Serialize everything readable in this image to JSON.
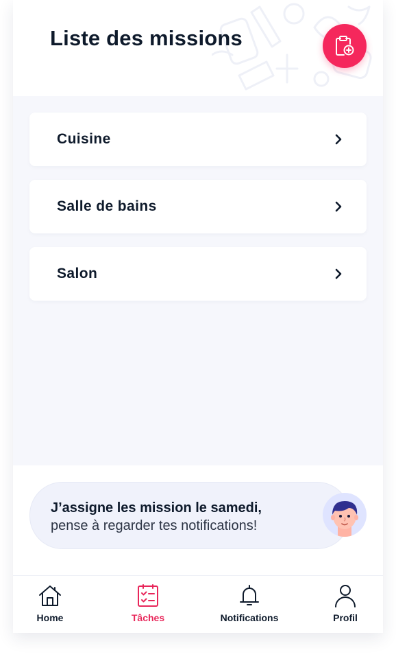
{
  "header": {
    "title": "Liste des missions",
    "add_button_icon": "clipboard-plus-icon",
    "background_icons": [
      "doodle-tools-icon"
    ]
  },
  "missions": [
    {
      "label": "Cuisine",
      "icon": "chevron-right-icon"
    },
    {
      "label": "Salle de bains",
      "icon": "chevron-right-icon"
    },
    {
      "label": "Salon",
      "icon": "chevron-right-icon"
    }
  ],
  "banner": {
    "bold_text": "J’assigne les mission le samedi,",
    "text": "pense à regarder tes notifications!",
    "avatar_icon": "child-avatar-icon"
  },
  "nav": {
    "items": [
      {
        "label": "Home",
        "icon": "house-icon"
      },
      {
        "label": "Tâches",
        "icon": "task-list-icon",
        "active": true
      },
      {
        "label": "Notifications",
        "icon": "bell-icon"
      },
      {
        "label": "Profil",
        "icon": "user-icon"
      }
    ]
  },
  "colors": {
    "accent": "#f5275c",
    "text_dark": "#0e1a2b",
    "background": "#f6f7fc",
    "active_nav": "#e8265a"
  }
}
